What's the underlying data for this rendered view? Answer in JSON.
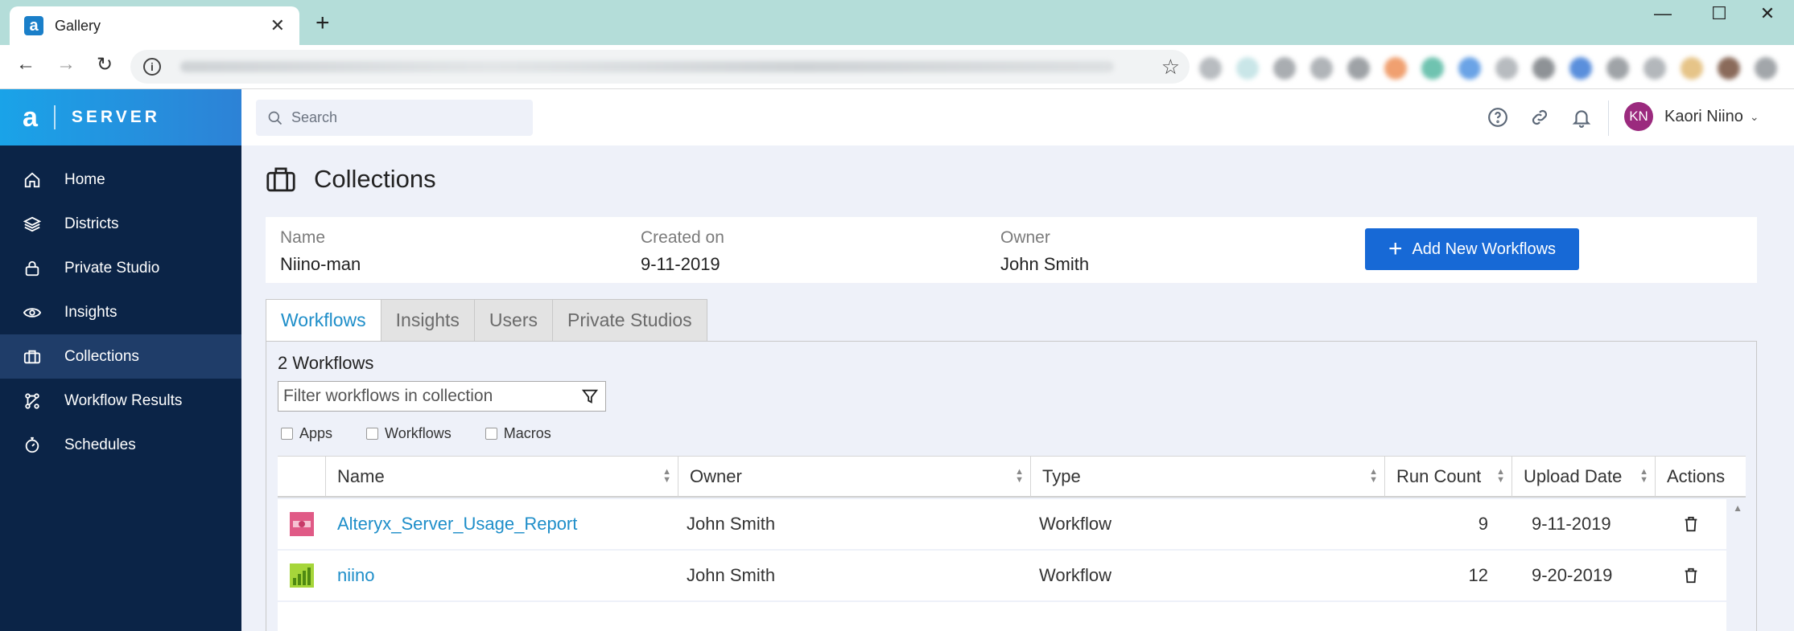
{
  "browser": {
    "tab_title": "Gallery",
    "tab_favicon": "a",
    "tab_close": "✕",
    "new_tab": "+"
  },
  "sidebar": {
    "brand_logo": "a",
    "brand_name": "SERVER",
    "items": [
      {
        "label": "Home",
        "icon": "home-icon"
      },
      {
        "label": "Districts",
        "icon": "layers-icon"
      },
      {
        "label": "Private Studio",
        "icon": "lock-icon"
      },
      {
        "label": "Insights",
        "icon": "eye-icon"
      },
      {
        "label": "Collections",
        "icon": "briefcase-icon",
        "active": true
      },
      {
        "label": "Workflow Results",
        "icon": "workflow-icon"
      },
      {
        "label": "Schedules",
        "icon": "stopwatch-icon"
      }
    ]
  },
  "header": {
    "search_placeholder": "Search",
    "user_initials": "KN",
    "user_name": "Kaori Niino",
    "avatar_color": "#9b2a7e"
  },
  "page": {
    "title": "Collections",
    "info": {
      "name_label": "Name",
      "name_value": "Niino-man",
      "created_label": "Created on",
      "created_value": "9-11-2019",
      "owner_label": "Owner",
      "owner_value": "John Smith"
    },
    "add_button": "Add New Workflows",
    "accent_color": "#1769d6"
  },
  "tabs": [
    "Workflows",
    "Insights",
    "Users",
    "Private Studios"
  ],
  "workflows": {
    "count_text": "2 Workflows",
    "filter_placeholder": "Filter workflows in collection",
    "checkboxes": [
      "Apps",
      "Workflows",
      "Macros"
    ],
    "columns": [
      "Name",
      "Owner",
      "Type",
      "Run Count",
      "Upload Date",
      "Actions"
    ],
    "rows": [
      {
        "name": "Alteryx_Server_Usage_Report",
        "owner": "John Smith",
        "type": "Workflow",
        "run_count": "9",
        "upload_date": "9-11-2019"
      },
      {
        "name": "niino",
        "owner": "John Smith",
        "type": "Workflow",
        "run_count": "12",
        "upload_date": "9-20-2019"
      }
    ]
  }
}
